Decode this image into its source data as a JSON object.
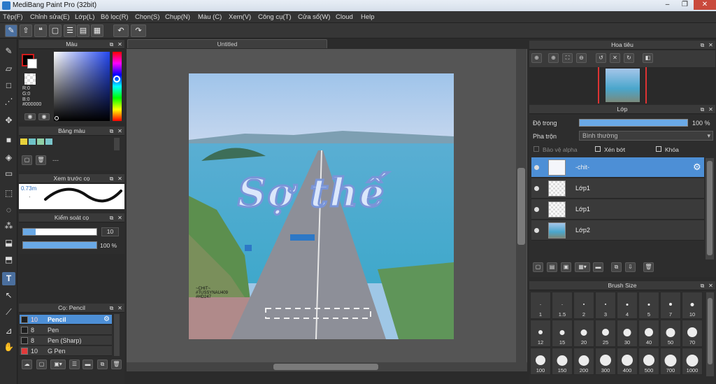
{
  "window": {
    "title": "MediBang Paint Pro (32bit)",
    "controls": [
      "–",
      "❐",
      "✕"
    ]
  },
  "menu": [
    "Tệp(F)",
    "Chỉnh sửa(E)",
    "Lớp(L)",
    "Bộ lọc(R)",
    "Chọn(S)",
    "Chụp(N)",
    "Màu (C)",
    "Xem(V)",
    "Công cụ(T)",
    "Cửa sổ(W)",
    "Cloud",
    "Help"
  ],
  "toolbar": {
    "icons": [
      "brush-tool-icon",
      "upload-icon",
      "speech-icon",
      "page-icon",
      "document-icon",
      "document-text-icon",
      "grid-icon"
    ],
    "undo": "↶",
    "redo": "↷"
  },
  "color_panel": {
    "title": "Màu",
    "r": "R:0",
    "g": "G:0",
    "b": "B:0",
    "hex": "#000000",
    "primary": "#000000",
    "secondary": "#ffffff",
    "fg_accent": "#d01c1c"
  },
  "palette_panel": {
    "title": "Bảng màu",
    "swatches": [
      "#e8d23b",
      "#6fc3c8",
      "#8fcfa5",
      "#7bc6cb"
    ],
    "placeholder": "---"
  },
  "brush_preview": {
    "title": "Xem trước cọ",
    "size": "0.73m"
  },
  "brush_control": {
    "title": "Kiểm soát cọ",
    "size": "10",
    "opacity": "100 %"
  },
  "brush_panel": {
    "title": "Cọ: Pencil",
    "items": [
      {
        "size": "10",
        "name": "Pencil",
        "color": "#1e1e1e",
        "selected": true
      },
      {
        "size": "8",
        "name": "Pen",
        "color": "#1e1e1e",
        "selected": false
      },
      {
        "size": "8",
        "name": "Pen (Sharp)",
        "color": "#1e1e1e",
        "selected": false
      },
      {
        "size": "10",
        "name": "G Pen",
        "color": "#e23a3a",
        "selected": false
      }
    ]
  },
  "canvas": {
    "tab": "Untitled",
    "art_title": "Sợ thế",
    "watermark": [
      "~CHIT~",
      "#TUSSYNAU409",
      "#HD247"
    ]
  },
  "navigator": {
    "title": "Hoa tiêu"
  },
  "layers": {
    "title": "Lớp",
    "opacity_label": "Độ trong",
    "opacity_value": "100 %",
    "opacity": 1.0,
    "blend_label": "Pha trộn",
    "blend_value": "Bình thường",
    "protect_alpha": "Bảo vệ alpha",
    "clipping": "Xén bớt",
    "lock": "Khóa",
    "items": [
      {
        "name": "-chit-",
        "selected": true
      },
      {
        "name": "Lớp1",
        "selected": false
      },
      {
        "name": "Lớp1",
        "selected": false
      },
      {
        "name": "Lớp2",
        "selected": false
      }
    ]
  },
  "brush_size": {
    "title": "Brush Size",
    "sizes": [
      "1",
      "1.5",
      "2",
      "3",
      "4",
      "5",
      "7",
      "10",
      "12",
      "15",
      "20",
      "25",
      "30",
      "40",
      "50",
      "70",
      "100",
      "150",
      "200",
      "300",
      "400",
      "500",
      "700",
      "1000"
    ]
  },
  "accent": "#4d8fd6"
}
